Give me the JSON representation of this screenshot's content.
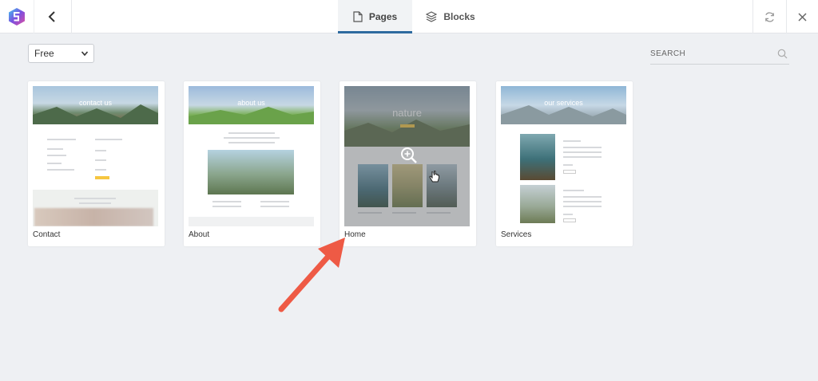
{
  "tabs": {
    "pages": "Pages",
    "blocks": "Blocks"
  },
  "filter": {
    "selected": "Free"
  },
  "search": {
    "placeholder": "SEARCH"
  },
  "cards": [
    {
      "label": "Contact",
      "hero_title": "contact us"
    },
    {
      "label": "About",
      "hero_title": "about us"
    },
    {
      "label": "Home",
      "hero_title": "nature"
    },
    {
      "label": "Services",
      "hero_title": "our services"
    }
  ],
  "colors": {
    "accent": "#2d6a9f",
    "logo": "#7b4fe0",
    "arrow": "#ee5a45"
  }
}
